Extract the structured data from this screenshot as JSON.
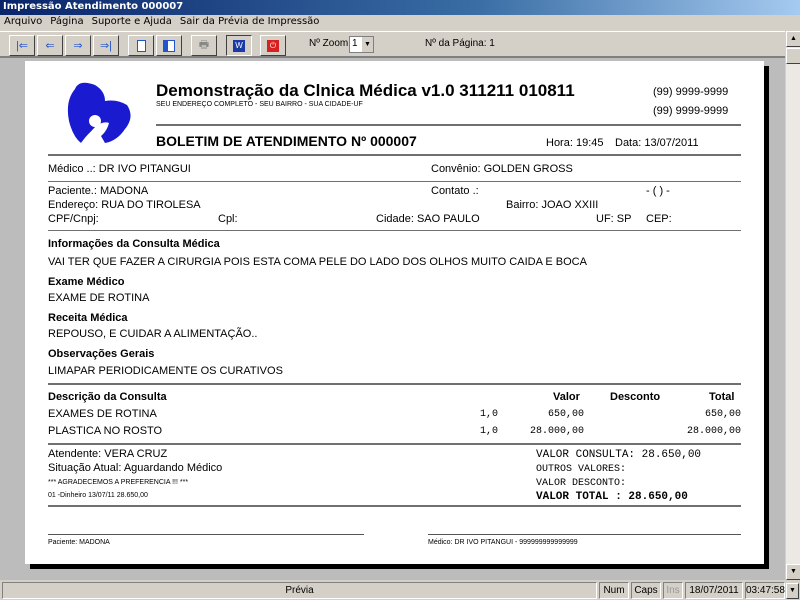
{
  "window": {
    "title": "Impressão Atendimento 000007"
  },
  "menu": [
    "Arquivo",
    "Página",
    "Suporte e Ajuda",
    "Sair da Prévia de Impressão"
  ],
  "toolbar": {
    "zoom_label": "Nº Zoom",
    "zoom_value": "1",
    "page_label": "Nº da Página: 1"
  },
  "report": {
    "clinic_name": "Demonstração da Clnica Médica v1.0 311211 010811",
    "address": "SEU ENDEREÇO COMPLETO - SEU BAIRRO - SUA CIDADE-UF",
    "phone1": "(99) 9999-9999",
    "phone2": "(99) 9999-9999",
    "doc_title": "BOLETIM DE ATENDIMENTO Nº 000007",
    "hora": "Hora: 19:45",
    "data": "Data: 13/07/2011",
    "medico": "Médico ..: DR IVO PITANGUI",
    "convenio": "Convênio: GOLDEN GROSS",
    "paciente": "Paciente.: MADONA",
    "contato": "Contato .:",
    "contato_phone": "- (  )   -",
    "endereco": "Endereço: RUA DO TIROLESA",
    "bairro": "Bairro: JOAO XXIII",
    "cpf": "CPF/Cnpj:",
    "cpl": "Cpl:",
    "cidade": "Cidade: SAO PAULO",
    "uf": "UF: SP",
    "cep": "CEP:",
    "info_title": "Informações da Consulta Médica",
    "info_text": "VAI TER QUE FAZER A CIRURGIA POIS ESTA COMA PELE DO LADO DOS OLHOS MUITO CAIDA E BOCA",
    "exame_title": "Exame Médico",
    "exame_text": "EXAME DE ROTINA",
    "receita_title": "Receita Médica",
    "receita_text": "REPOUSO, E CUIDAR A ALIMENTAÇÃO..",
    "obs_title": "Observações Gerais",
    "obs_text": "LIMAPAR PERIODICAMENTE OS CURATIVOS",
    "table_headers": [
      "Descrição da Consulta",
      "Valor",
      "Desconto",
      "Total"
    ],
    "items": [
      {
        "desc": "EXAMES DE ROTINA",
        "qty": "1,0",
        "valor": "650,00",
        "total": "650,00"
      },
      {
        "desc": "PLASTICA NO ROSTO",
        "qty": "1,0",
        "valor": "28.000,00",
        "total": "28.000,00"
      }
    ],
    "atendente": "Atendente: VERA CRUZ",
    "situacao": "Situação Atual: Aguardando Médico",
    "agradecimento": "*** AGRADECEMOS A PREFERENCIA !!! ***",
    "pagamento": "01 -Dinheiro     13/07/11 28.650,00",
    "valor_consulta": "VALOR CONSULTA: 28.650,00",
    "outros": "OUTROS VALORES:",
    "desconto": "VALOR DESCONTO:",
    "valor_total": "VALOR TOTAL   : 28.650,00",
    "sig_paciente": "Paciente: MADONA",
    "sig_medico": "Médico: DR IVO PITANGUI - 999999999999999"
  },
  "status": {
    "main": "Prévia",
    "num": "Num",
    "caps": "Caps",
    "ins": "Ins",
    "date": "18/07/2011",
    "time": "03:47:58"
  },
  "colors": {
    "logo": "#1a1ad0",
    "titlebar": "#0a246a"
  }
}
